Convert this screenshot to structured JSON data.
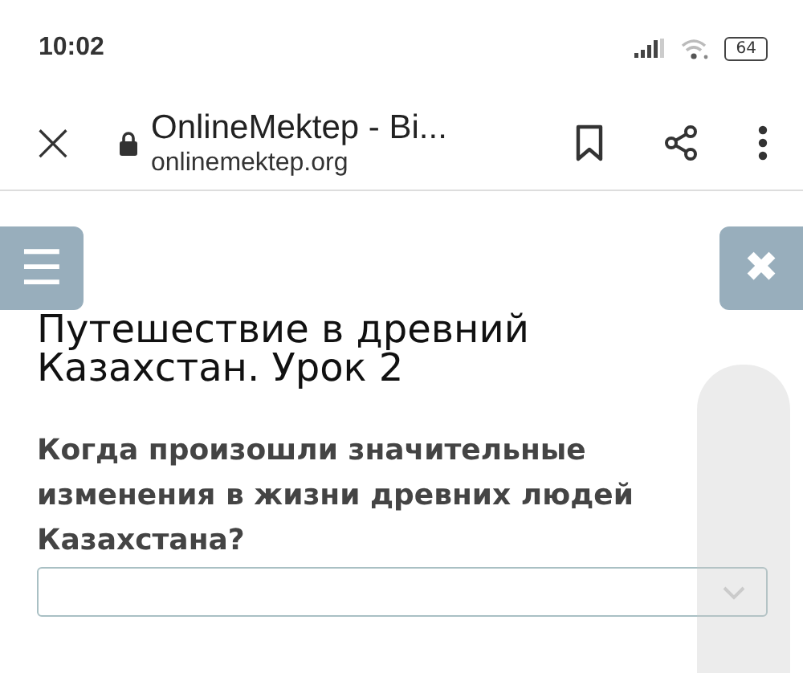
{
  "status_bar": {
    "time": "10:02",
    "battery": "64"
  },
  "browser_bar": {
    "close": "×",
    "page_title": "OnlineMektep - Bi...",
    "url": "onlinemektep.org"
  },
  "page": {
    "menu_button": "☰",
    "close_button": "✖",
    "title": "Путешествие в древний Казахстан. Урок 2",
    "question": "Когда произошли значительные изменения в жизни древних людей Казахстана?",
    "answer_dropdown": {
      "expanded": false
    }
  }
}
